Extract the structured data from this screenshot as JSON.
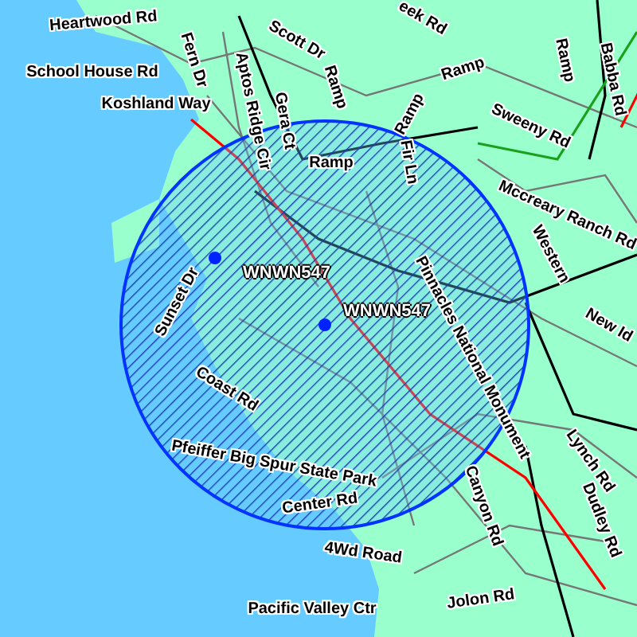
{
  "map": {
    "road_labels": [
      {
        "text": "Heartwood Rd"
      },
      {
        "text": "Fern Dr"
      },
      {
        "text": "Scott Dr"
      },
      {
        "text": "School House Rd"
      },
      {
        "text": "Koshland Way"
      },
      {
        "text": "Aptos Ridge Cir"
      },
      {
        "text": "Gera Ct"
      },
      {
        "text": "Ramp"
      },
      {
        "text": "eek Rd"
      },
      {
        "text": "Ramp"
      },
      {
        "text": "Ramp"
      },
      {
        "text": "Ramp"
      },
      {
        "text": "Babba Rd"
      },
      {
        "text": "Sweeny Rd"
      },
      {
        "text": "Ramp"
      },
      {
        "text": "Fir Ln"
      },
      {
        "text": "Mccreary Ranch Rd"
      },
      {
        "text": "Western"
      },
      {
        "text": "New Id"
      },
      {
        "text": "Pinnacles National Monument"
      },
      {
        "text": "Sunset Dr"
      },
      {
        "text": "Coast Rd"
      },
      {
        "text": "Pfeiffer Big Spur State Park"
      },
      {
        "text": "Center Rd"
      },
      {
        "text": "Canyon Rd"
      },
      {
        "text": "Lynch Rd"
      },
      {
        "text": "Dudley Rd"
      },
      {
        "text": "4Wd Road"
      },
      {
        "text": "Jolon Rd"
      },
      {
        "text": "Pacific Valley Ctr"
      }
    ],
    "stations": [
      {
        "label": "WNWN547"
      },
      {
        "label": "WNWN547"
      }
    ]
  }
}
